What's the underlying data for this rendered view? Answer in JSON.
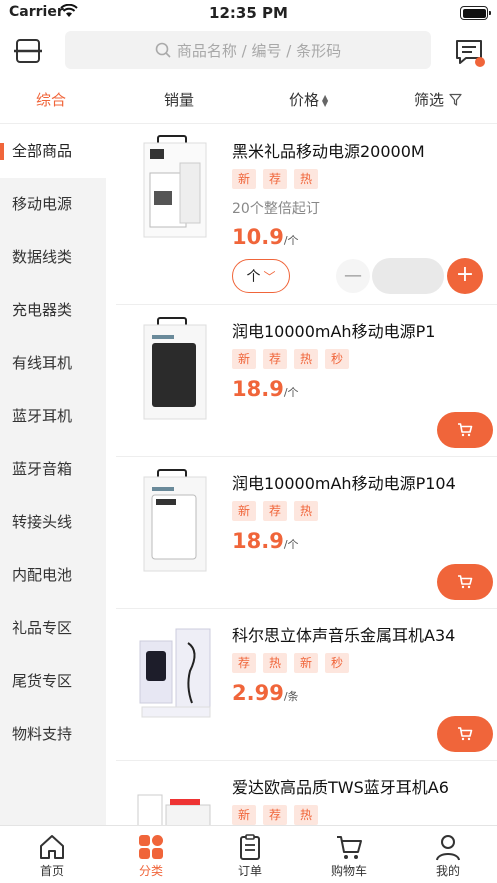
{
  "status_bar": {
    "carrier": "Carrier",
    "time": "12:35 PM"
  },
  "header": {
    "search_placeholder": "商品名称 / 编号 / 条形码"
  },
  "filter_tabs": [
    {
      "label": "综合",
      "active": true
    },
    {
      "label": "销量"
    },
    {
      "label": "价格"
    },
    {
      "label": "筛选"
    }
  ],
  "sidebar": {
    "items": [
      {
        "label": "全部商品",
        "active": true
      },
      {
        "label": "移动电源"
      },
      {
        "label": "数据线类"
      },
      {
        "label": "充电器类"
      },
      {
        "label": "有线耳机"
      },
      {
        "label": "蓝牙耳机"
      },
      {
        "label": "蓝牙音箱"
      },
      {
        "label": "转接头线"
      },
      {
        "label": "内配电池"
      },
      {
        "label": "礼品专区"
      },
      {
        "label": "尾货专区"
      },
      {
        "label": "物料支持"
      }
    ]
  },
  "products": [
    {
      "name": "黑米礼品移动电源20000M",
      "tags": [
        "新",
        "荐",
        "热"
      ],
      "moq": "20个整倍起订",
      "price": "10.9",
      "unit": "/个",
      "unit_select": "个",
      "stepper_minus": "—",
      "stepper_plus": "+"
    },
    {
      "name": "润电10000mAh移动电源P1",
      "tags": [
        "新",
        "荐",
        "热",
        "秒"
      ],
      "price": "18.9",
      "unit": "/个"
    },
    {
      "name": "润电10000mAh移动电源P104",
      "tags": [
        "新",
        "荐",
        "热"
      ],
      "price": "18.9",
      "unit": "/个"
    },
    {
      "name": "科尔思立体声音乐金属耳机A34",
      "tags": [
        "荐",
        "热",
        "新",
        "秒"
      ],
      "price": "2.99",
      "unit": "/条"
    },
    {
      "name": "爱达欧高品质TWS蓝牙耳机A6",
      "tags": [
        "新",
        "荐",
        "热"
      ],
      "price": "",
      "unit": ""
    }
  ],
  "bottom_nav": [
    {
      "label": "首页",
      "icon": "home-icon"
    },
    {
      "label": "分类",
      "icon": "category-icon",
      "active": true
    },
    {
      "label": "订单",
      "icon": "order-icon"
    },
    {
      "label": "购物车",
      "icon": "cart-icon"
    },
    {
      "label": "我的",
      "icon": "user-icon"
    }
  ],
  "colors": {
    "accent": "#f0653a",
    "tag_bg": "#fde6de",
    "sidebar_bg": "#f3f3f3"
  }
}
